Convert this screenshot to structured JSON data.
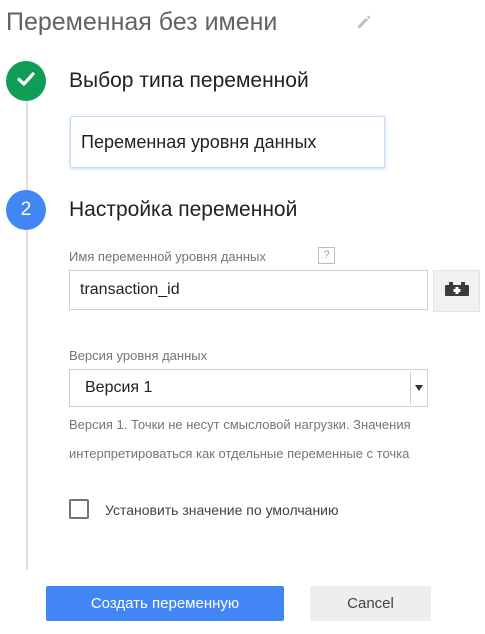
{
  "page": {
    "title": "Переменная без имени",
    "edit_icon": "pencil-icon"
  },
  "step1": {
    "icon": "check-icon",
    "title": "Выбор типа переменной",
    "selected_type": "Переменная уровня данных"
  },
  "step2": {
    "number": "2",
    "title": "Настройка переменной",
    "dl_name_label": "Имя переменной уровня данных",
    "help_badge": "?",
    "dl_name_value": "transaction_id",
    "variable_picker_icon": "lego-brick-plus-icon",
    "version_label": "Версия уровня данных",
    "version_value": "Версия 1",
    "version_help_line1": "Версия 1. Точки не несут смысловой нагрузки. Значения",
    "version_help_line2": "интерпретироваться как отдельные переменные с точка",
    "default_value_checkbox_label": "Установить значение по умолчанию",
    "default_value_checked": false
  },
  "actions": {
    "create_label": "Создать переменную",
    "cancel_label": "Cancel"
  },
  "colors": {
    "accent_blue": "#4285f4",
    "success_green": "#0f9d58"
  }
}
